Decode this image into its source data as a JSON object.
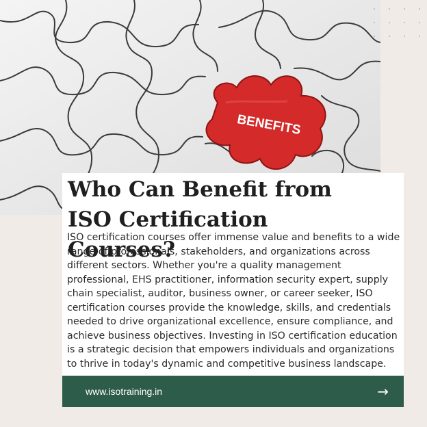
{
  "hero": {
    "puzzle_label": "BENEFITS",
    "piece_color": "#d42a2a"
  },
  "article": {
    "title": "Who Can Benefit from ISO Certification Courses?",
    "body": "ISO certification courses offer immense value and benefits to a wide range of professionals, stakeholders, and organizations across different sectors. Whether you're a quality management professional, EHS practitioner, information security expert, supply chain specialist, auditor, business owner, or career seeker, ISO certification courses provide the knowledge, skills, and credentials needed to drive organizational excellence, ensure compliance, and achieve business objectives. Investing in ISO certification education is a strategic decision that empowers individuals and organizations to thrive in today's dynamic and competitive business landscape."
  },
  "footer": {
    "url": "www.isotraining.in",
    "arrow_icon": "arrow-right-icon",
    "background": "#2e5c4a"
  }
}
